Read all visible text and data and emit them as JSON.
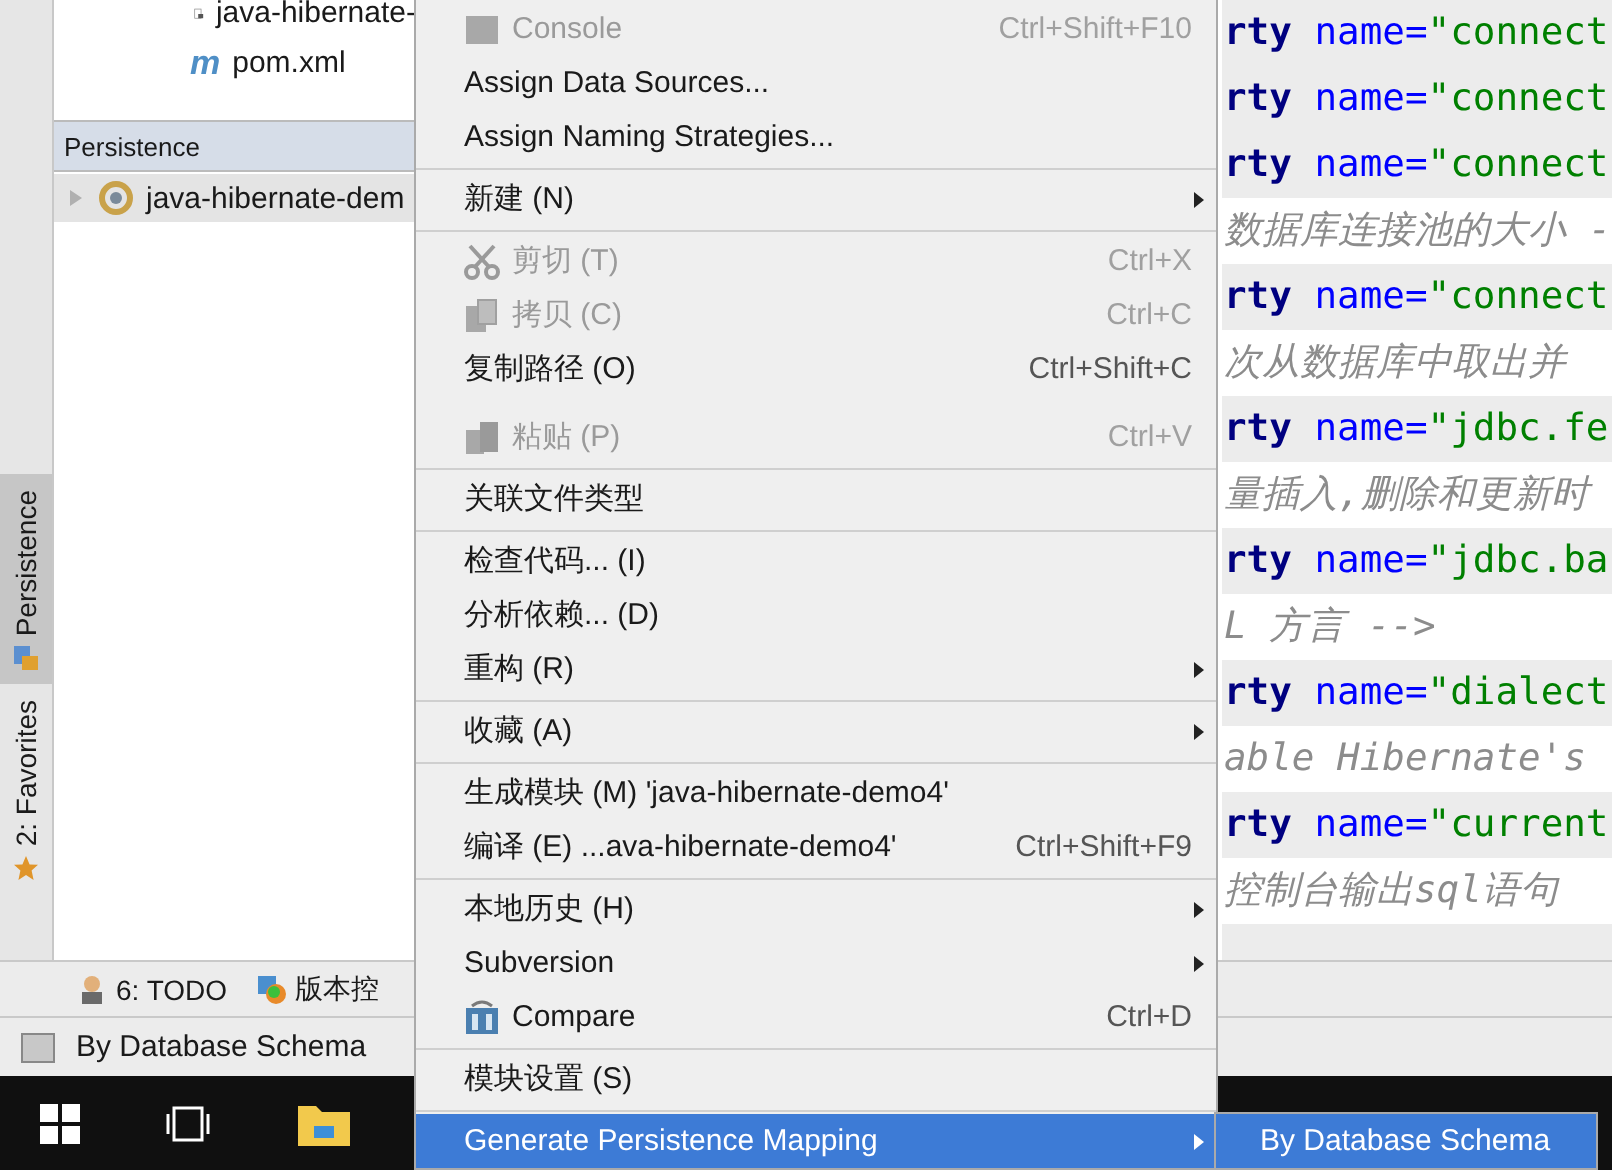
{
  "project_tree": {
    "items": [
      {
        "label": "java-hibernate-"
      },
      {
        "label": "pom.xml",
        "icon_glyph": "m"
      }
    ]
  },
  "persistence_panel": {
    "title": "Persistence",
    "rows": [
      {
        "label": "java-hibernate-dem",
        "selected": true,
        "expanded": false
      }
    ]
  },
  "side_tabs": [
    {
      "label": "Persistence",
      "selected": true
    },
    {
      "label": "2: Favorites",
      "selected": false
    }
  ],
  "editor_lines": [
    {
      "kind": "code",
      "tag": "rty",
      "attr": "name=",
      "value": "\"connect"
    },
    {
      "kind": "code",
      "tag": "rty",
      "attr": "name=",
      "value": "\"connect"
    },
    {
      "kind": "code",
      "tag": "rty",
      "attr": "name=",
      "value": "\"connect"
    },
    {
      "kind": "comment",
      "text": "数据库连接池的大小 -"
    },
    {
      "kind": "code",
      "tag": "rty",
      "attr": "name=",
      "value": "\"connect"
    },
    {
      "kind": "comment",
      "text": "次从数据库中取出并"
    },
    {
      "kind": "code",
      "tag": "rty",
      "attr": "name=",
      "value": "\"jdbc.fe"
    },
    {
      "kind": "comment",
      "text": "量插入,删除和更新时"
    },
    {
      "kind": "code",
      "tag": "rty",
      "attr": "name=",
      "value": "\"jdbc.ba"
    },
    {
      "kind": "comment",
      "text": "L 方言 -->"
    },
    {
      "kind": "code",
      "tag": "rty",
      "attr": "name=",
      "value": "\"dialect"
    },
    {
      "kind": "comment",
      "text": "able Hibernate's"
    },
    {
      "kind": "code",
      "tag": "rty",
      "attr": "name=",
      "value": "\"current"
    },
    {
      "kind": "comment",
      "text": "控制台输出sql语句"
    }
  ],
  "bottom_tools": [
    {
      "label": "6: TODO"
    },
    {
      "label": "版本控"
    }
  ],
  "status_bar": {
    "text": "By Database Schema"
  },
  "context_menu": {
    "items": [
      {
        "kind": "item",
        "label": "Console",
        "shortcut": "Ctrl+Shift+F10",
        "disabled": true,
        "submenu": false,
        "selected": false
      },
      {
        "kind": "item",
        "label": "Assign Data Sources...",
        "disabled": false,
        "submenu": false,
        "selected": false
      },
      {
        "kind": "item",
        "label": "Assign Naming Strategies...",
        "disabled": false,
        "submenu": false,
        "selected": false
      },
      {
        "kind": "separator"
      },
      {
        "kind": "item",
        "label": "新建 (N)",
        "disabled": false,
        "submenu": true,
        "selected": false
      },
      {
        "kind": "separator"
      },
      {
        "kind": "item",
        "label": "剪切 (T)",
        "shortcut": "Ctrl+X",
        "disabled": true,
        "submenu": false,
        "selected": false
      },
      {
        "kind": "item",
        "label": "拷贝 (C)",
        "shortcut": "Ctrl+C",
        "disabled": true,
        "submenu": false,
        "selected": false
      },
      {
        "kind": "item",
        "label": "复制路径 (O)",
        "shortcut": "Ctrl+Shift+C",
        "disabled": false,
        "submenu": false,
        "selected": false
      },
      {
        "kind": "gap"
      },
      {
        "kind": "item",
        "label": "粘贴 (P)",
        "shortcut": "Ctrl+V",
        "disabled": true,
        "submenu": false,
        "selected": false
      },
      {
        "kind": "separator"
      },
      {
        "kind": "item",
        "label": "关联文件类型",
        "disabled": false,
        "submenu": false,
        "selected": false
      },
      {
        "kind": "separator"
      },
      {
        "kind": "item",
        "label": "检查代码... (I)",
        "disabled": false,
        "submenu": false,
        "selected": false
      },
      {
        "kind": "item",
        "label": "分析依赖... (D)",
        "disabled": false,
        "submenu": false,
        "selected": false
      },
      {
        "kind": "item",
        "label": "重构 (R)",
        "disabled": false,
        "submenu": true,
        "selected": false
      },
      {
        "kind": "separator"
      },
      {
        "kind": "item",
        "label": "收藏 (A)",
        "disabled": false,
        "submenu": true,
        "selected": false
      },
      {
        "kind": "separator"
      },
      {
        "kind": "item",
        "label": "生成模块 (M) 'java-hibernate-demo4'",
        "disabled": false,
        "submenu": false,
        "selected": false
      },
      {
        "kind": "item",
        "label": "编译 (E) ...ava-hibernate-demo4'",
        "shortcut": "Ctrl+Shift+F9",
        "disabled": false,
        "submenu": false,
        "selected": false
      },
      {
        "kind": "separator"
      },
      {
        "kind": "item",
        "label": "本地历史 (H)",
        "disabled": false,
        "submenu": true,
        "selected": false
      },
      {
        "kind": "item",
        "label": "Subversion",
        "disabled": false,
        "submenu": true,
        "selected": false
      },
      {
        "kind": "item",
        "label": "Compare",
        "shortcut": "Ctrl+D",
        "disabled": false,
        "submenu": false,
        "selected": false
      },
      {
        "kind": "separator"
      },
      {
        "kind": "item",
        "label": "模块设置 (S)",
        "disabled": false,
        "submenu": false,
        "selected": false
      },
      {
        "kind": "separator"
      },
      {
        "kind": "item",
        "label": "Generate Persistence Mapping",
        "disabled": false,
        "submenu": true,
        "selected": true
      }
    ]
  },
  "submenu": {
    "items": [
      {
        "label": "By Database Schema",
        "selected": true
      }
    ]
  }
}
